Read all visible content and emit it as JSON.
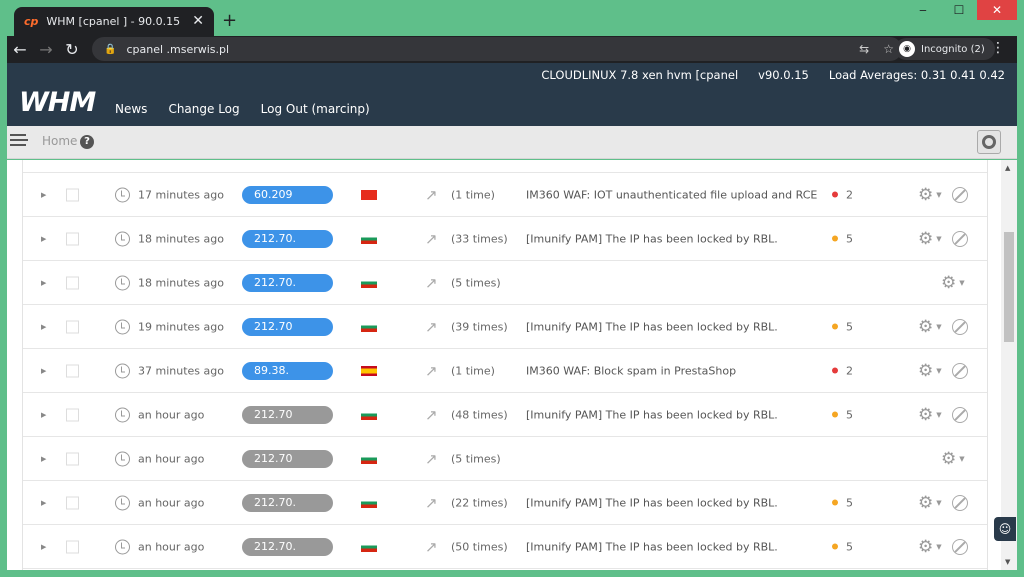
{
  "browser": {
    "tab_title": "WHM [cpanel     ] - 90.0.15",
    "tab_icon": "cp",
    "new_tab": "+",
    "close_tab": "✕",
    "url": "cpanel     .mserwis.pl",
    "incognito_label": "Incognito (2)",
    "window_controls": {
      "minimize": "‒",
      "maximize": "☐",
      "close": "✕"
    }
  },
  "header": {
    "logo": "WHM",
    "system": "CLOUDLINUX 7.8 xen hvm [cpanel",
    "version": "v90.0.15",
    "load_averages": "Load Averages: 0.31 0.41 0.42",
    "nav": [
      {
        "label": "News"
      },
      {
        "label": "Change Log"
      },
      {
        "label": "Log Out (marcinp)"
      }
    ]
  },
  "breadcrumb": {
    "home": "Home",
    "help": "?"
  },
  "incidents": [
    {
      "time": "17 minutes ago",
      "ip": "60.209",
      "ip_status": "blue",
      "country": "cn",
      "times": "(1 time)",
      "description": "IM360 WAF: IOT unauthenticated file upload and RCE",
      "severity": "2",
      "severity_color": "red",
      "blockable": true
    },
    {
      "time": "18 minutes ago",
      "ip": "212.70.",
      "ip_status": "blue",
      "country": "bg",
      "times": "(33 times)",
      "description": "[Imunify PAM] The IP has been locked by RBL.",
      "severity": "5",
      "severity_color": "orange",
      "blockable": true
    },
    {
      "time": "18 minutes ago",
      "ip": "212.70.",
      "ip_status": "blue",
      "country": "bg",
      "times": "(5 times)",
      "description": "",
      "severity": "",
      "severity_color": "",
      "blockable": false
    },
    {
      "time": "19 minutes ago",
      "ip": "212.70",
      "ip_status": "blue",
      "country": "bg",
      "times": "(39 times)",
      "description": "[Imunify PAM] The IP has been locked by RBL.",
      "severity": "5",
      "severity_color": "orange",
      "blockable": true
    },
    {
      "time": "37 minutes ago",
      "ip": "89.38.",
      "ip_status": "blue",
      "country": "es",
      "times": "(1 time)",
      "description": "IM360 WAF: Block spam in PrestaShop",
      "severity": "2",
      "severity_color": "red",
      "blockable": true
    },
    {
      "time": "an hour ago",
      "ip": "212.70",
      "ip_status": "gray",
      "country": "bg",
      "times": "(48 times)",
      "description": "[Imunify PAM] The IP has been locked by RBL.",
      "severity": "5",
      "severity_color": "orange",
      "blockable": true
    },
    {
      "time": "an hour ago",
      "ip": "212.70",
      "ip_status": "gray",
      "country": "bg",
      "times": "(5 times)",
      "description": "",
      "severity": "",
      "severity_color": "",
      "blockable": false
    },
    {
      "time": "an hour ago",
      "ip": "212.70.",
      "ip_status": "gray",
      "country": "bg",
      "times": "(22 times)",
      "description": "[Imunify PAM] The IP has been locked by RBL.",
      "severity": "5",
      "severity_color": "orange",
      "blockable": true
    },
    {
      "time": "an hour ago",
      "ip": "212.70.",
      "ip_status": "gray",
      "country": "bg",
      "times": "(50 times)",
      "description": "[Imunify PAM] The IP has been locked by RBL.",
      "severity": "5",
      "severity_color": "orange",
      "blockable": true
    }
  ],
  "colors": {
    "header_bg": "#293a4a",
    "ip_active": "#3d93e8",
    "ip_inactive": "#999999",
    "sev_high": "#e53b3b",
    "sev_medium": "#f5a623"
  }
}
